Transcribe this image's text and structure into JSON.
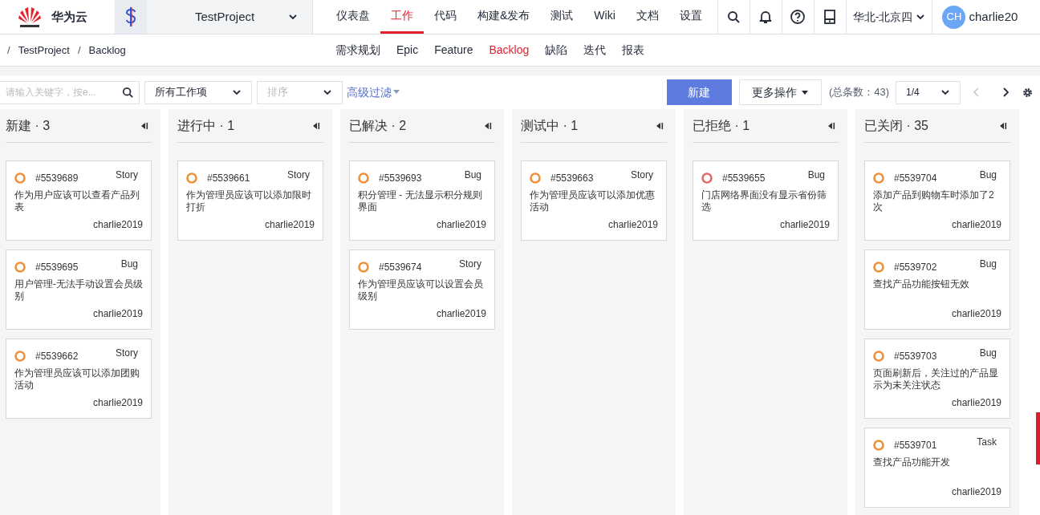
{
  "brand": "华为云",
  "project": {
    "name": "TestProject"
  },
  "nav": [
    {
      "label": "仪表盘",
      "selected": false
    },
    {
      "label": "工作",
      "selected": true
    },
    {
      "label": "代码",
      "selected": false
    },
    {
      "label": "构建&发布",
      "selected": false
    },
    {
      "label": "测试",
      "selected": false
    },
    {
      "label": "Wiki",
      "selected": false
    },
    {
      "label": "文档",
      "selected": false
    },
    {
      "label": "设置",
      "selected": false
    }
  ],
  "region": "华北-北京四",
  "user": {
    "initials": "CH",
    "name": "charlie20"
  },
  "breadcrumb": [
    {
      "separator": "/",
      "label": "TestProject"
    },
    {
      "separator": "/",
      "label": "Backlog"
    }
  ],
  "subnav": [
    {
      "label": "需求规划",
      "selected": false
    },
    {
      "label": "Epic",
      "selected": false
    },
    {
      "label": "Feature",
      "selected": false
    },
    {
      "label": "Backlog",
      "selected": true
    },
    {
      "label": "缺陷",
      "selected": false
    },
    {
      "label": "迭代",
      "selected": false
    },
    {
      "label": "报表",
      "selected": false
    }
  ],
  "toolbar": {
    "search": {
      "placeholder": "请输入关键字，按e..."
    },
    "type_filter": "所有工作项",
    "sort": {
      "placeholder": "排序"
    },
    "advanced_filter": "高级过滤",
    "new_button": "新建",
    "more_button": "更多操作",
    "total": "(总条数：43)",
    "page": "1/4"
  },
  "columns": [
    {
      "title": "新建 · 3",
      "cards": [
        {
          "id": "#5539689",
          "type": "Story",
          "title": "作为用户应该可以查看产品列表",
          "owner": "charlie2019",
          "color": "#f0913a"
        },
        {
          "id": "#5539695",
          "type": "Bug",
          "title": "用户管理-无法手动设置会员级别",
          "owner": "charlie2019",
          "color": "#f0913a"
        },
        {
          "id": "#5539662",
          "type": "Story",
          "title": "作为管理员应该可以添加团购活动",
          "owner": "charlie2019",
          "color": "#f0913a"
        }
      ]
    },
    {
      "title": "进行中 · 1",
      "cards": [
        {
          "id": "#5539661",
          "type": "Story",
          "title": "作为管理员应该可以添加限时打折",
          "owner": "charlie2019",
          "color": "#f0913a"
        }
      ]
    },
    {
      "title": "已解决 · 2",
      "cards": [
        {
          "id": "#5539693",
          "type": "Bug",
          "title": "积分管理 - 无法显示积分规则界面",
          "owner": "charlie2019",
          "color": "#f0913a"
        },
        {
          "id": "#5539674",
          "type": "Story",
          "title": "作为管理员应该可以设置会员级别",
          "owner": "charlie2019",
          "color": "#f0913a"
        }
      ]
    },
    {
      "title": "测试中 · 1",
      "cards": [
        {
          "id": "#5539663",
          "type": "Story",
          "title": "作为管理员应该可以添加优惠活动",
          "owner": "charlie2019",
          "color": "#f0913a"
        }
      ]
    },
    {
      "title": "已拒绝 · 1",
      "cards": [
        {
          "id": "#5539655",
          "type": "Bug",
          "title": "门店网络界面没有显示省份筛选",
          "owner": "charlie2019",
          "color": "#e06a6a"
        }
      ]
    },
    {
      "title": "已关闭 · 35",
      "cards": [
        {
          "id": "#5539704",
          "type": "Bug",
          "title": "添加产品到购物车时添加了2次",
          "owner": "charlie2019",
          "color": "#f0913a"
        },
        {
          "id": "#5539702",
          "type": "Bug",
          "title": "查找产品功能按钮无效",
          "owner": "charlie2019",
          "color": "#f0913a"
        },
        {
          "id": "#5539703",
          "type": "Bug",
          "title": "页面刷新后，关注过的产品显示为未关注状态",
          "owner": "charlie2019",
          "color": "#f0913a"
        },
        {
          "id": "#5539701",
          "type": "Task",
          "title": "查找产品功能开发",
          "owner": "charlie2019",
          "color": "#f0913a"
        }
      ]
    }
  ]
}
